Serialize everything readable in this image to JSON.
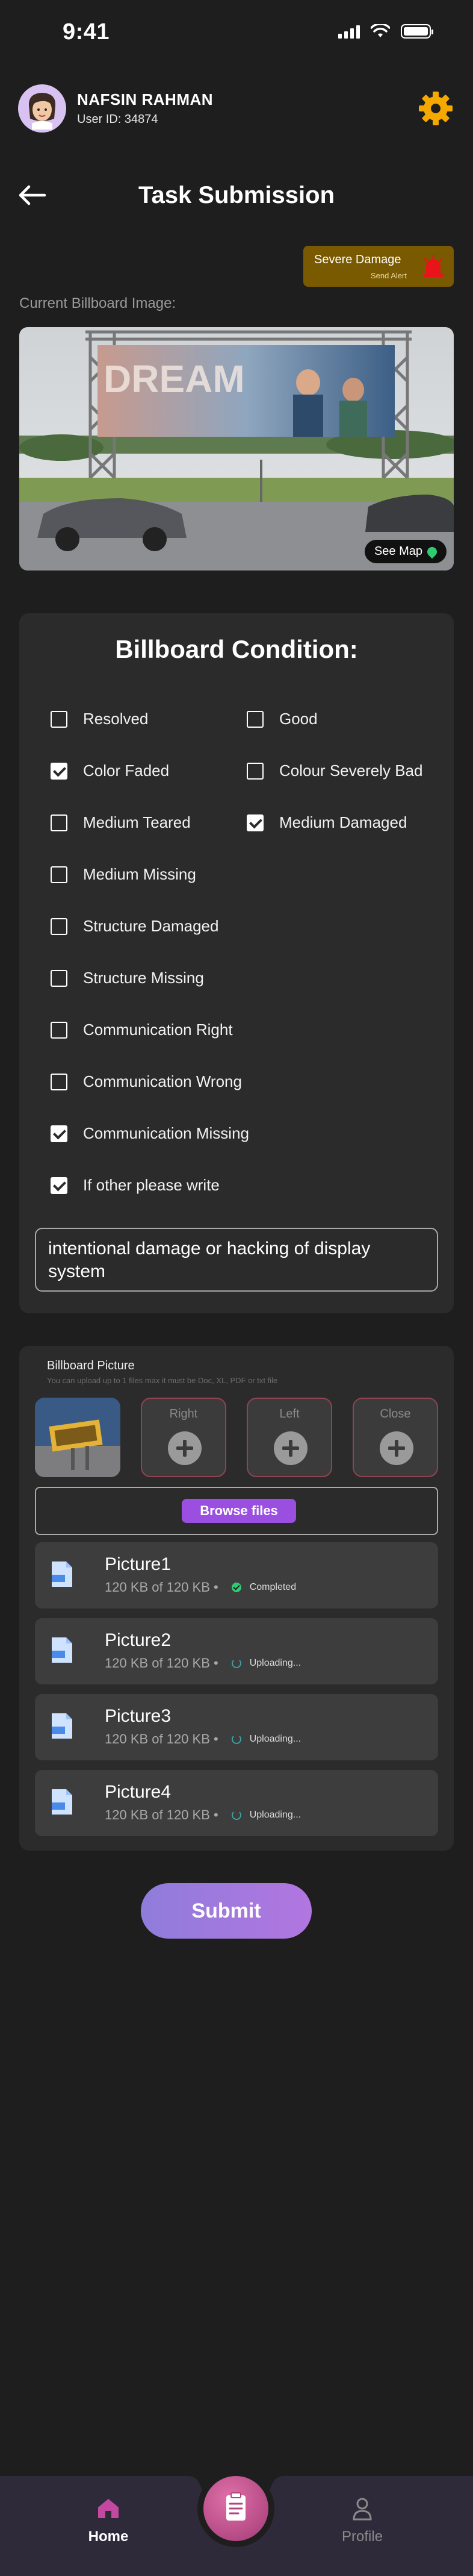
{
  "status": {
    "time": "9:41"
  },
  "user": {
    "name": "NAFSIN RAHMAN",
    "id": "User ID: 34874"
  },
  "header": {
    "title": "Task Submission"
  },
  "alert": {
    "title": "Severe Damage",
    "subtitle": "Send Alert",
    "color": "#7a5a00"
  },
  "billboard": {
    "label": "Current Billboard Image:",
    "map_label": "See Map",
    "sign_text": "DREAM"
  },
  "condition": {
    "title": "Billboard Condition:",
    "items": [
      {
        "label": "Resolved",
        "checked": false
      },
      {
        "label": "Good",
        "checked": false
      },
      {
        "label": "Color Faded",
        "checked": true
      },
      {
        "label": "Colour Severely Bad",
        "checked": false
      },
      {
        "label": "Medium Teared",
        "checked": false
      },
      {
        "label": "Medium Damaged",
        "checked": true
      },
      {
        "label": "Medium Missing",
        "checked": false
      },
      {
        "label": "Structure Damaged",
        "checked": false
      },
      {
        "label": "Structure Missing",
        "checked": false
      },
      {
        "label": "Communication Right",
        "checked": false
      },
      {
        "label": "Communication Wrong",
        "checked": false
      },
      {
        "label": "Communication Missing",
        "checked": true
      },
      {
        "label": "If other please write",
        "checked": true
      }
    ],
    "other_text": "intentional damage or hacking of display system"
  },
  "pictures": {
    "title": "Billboard Picture",
    "note": "You can upload up to 1 files max it must be Doc, XL, PDF or txt file",
    "slots": [
      "Right",
      "Left",
      "Close"
    ],
    "browse_label": "Browse files",
    "files": [
      {
        "name": "Picture1",
        "size": "120 KB of 120 KB •",
        "status": "Completed"
      },
      {
        "name": "Picture2",
        "size": "120 KB of 120 KB •",
        "status": "Uploading..."
      },
      {
        "name": "Picture3",
        "size": "120 KB of 120 KB •",
        "status": "Uploading..."
      },
      {
        "name": "Picture4",
        "size": "120 KB of 120 KB •",
        "status": "Uploading..."
      }
    ]
  },
  "submit_label": "Submit",
  "nav": {
    "home": "Home",
    "profile": "Profile"
  },
  "colors": {
    "background": "#1e1e1e",
    "card": "#2b2b2b",
    "accent": "#9b4fe0",
    "gear": "#f5a800",
    "nav": "#2f2a3a"
  }
}
